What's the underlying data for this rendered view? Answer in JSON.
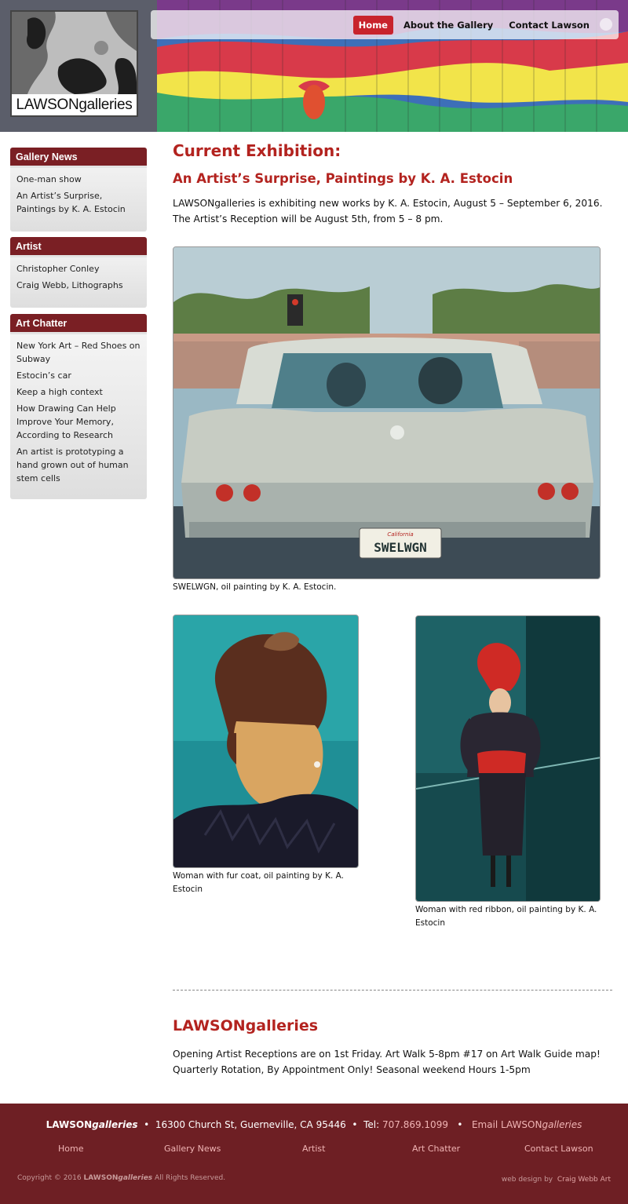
{
  "logo": {
    "text": "LAWSONgalleries"
  },
  "nav": {
    "items": [
      {
        "label": "Home",
        "active": true
      },
      {
        "label": "About the Gallery",
        "active": false
      },
      {
        "label": "Contact Lawson",
        "active": false
      }
    ],
    "rss_icon": "rss-icon"
  },
  "sidebar": {
    "gallery_news": {
      "title": "Gallery News",
      "items": [
        "One-man show",
        "An Artist’s Surprise, Paintings by K. A. Estocin"
      ]
    },
    "artist": {
      "title": "Artist",
      "items": [
        "Christopher Conley",
        "Craig Webb, Lithographs"
      ]
    },
    "art_chatter": {
      "title": "Art Chatter",
      "items": [
        "New York Art – Red Shoes on Subway",
        "Estocin’s car",
        "Keep a high context",
        "How Drawing Can Help Improve Your Memory, According to Research",
        "An artist is prototyping a hand grown out of human stem cells"
      ]
    }
  },
  "main": {
    "heading": "Current Exhibition:",
    "subheading": "An Artist’s Surprise, Paintings by K. A. Estocin",
    "intro": "LAWSONgalleries is exhibiting new works by K. A. Estocin, August 5 – September 6, 2016. The Artist’s Reception will be August 5th, from 5 – 8 pm.",
    "paintings": [
      {
        "caption": "SWELWGN, oil painting by K. A. Estocin.",
        "plate": "SWELWGN",
        "plate_state": "California"
      },
      {
        "caption": "Woman with fur coat, oil painting by K. A. Estocin"
      },
      {
        "caption": "Woman with red ribbon, oil painting by K. A. Estocin"
      }
    ]
  },
  "info": {
    "title": "LAWSONgalleries",
    "text": "Opening Artist Receptions are on 1st Friday. Art Walk 5-8pm #17 on Art Walk Guide map! Quarterly Rotation, By Appointment Only! Seasonal weekend Hours 1-5pm"
  },
  "footer": {
    "brand_main": "LAWSON",
    "brand_em": "galleries",
    "address": "16300 Church St, Guerneville, CA 95446",
    "tel_label": "Tel:",
    "tel": "707.869.1099",
    "email_prefix": "Email LAWSON",
    "email_em": "galleries",
    "links": [
      "Home",
      "Gallery News",
      "Artist",
      "Art Chatter",
      "Contact Lawson"
    ],
    "copyright_prefix": "Copyright © 2016",
    "copyright_brand": "LAWSON",
    "copyright_brand_em": "galleries",
    "copyright_suffix": "All Rights Reserved.",
    "credit_prefix": "web design by",
    "credit_link": "Craig Webb Art"
  },
  "colors": {
    "accent_red": "#b3231f",
    "nav_active": "#c8232c",
    "sidebar_header": "#7a1f24",
    "footer_bg": "#6e1f24"
  }
}
